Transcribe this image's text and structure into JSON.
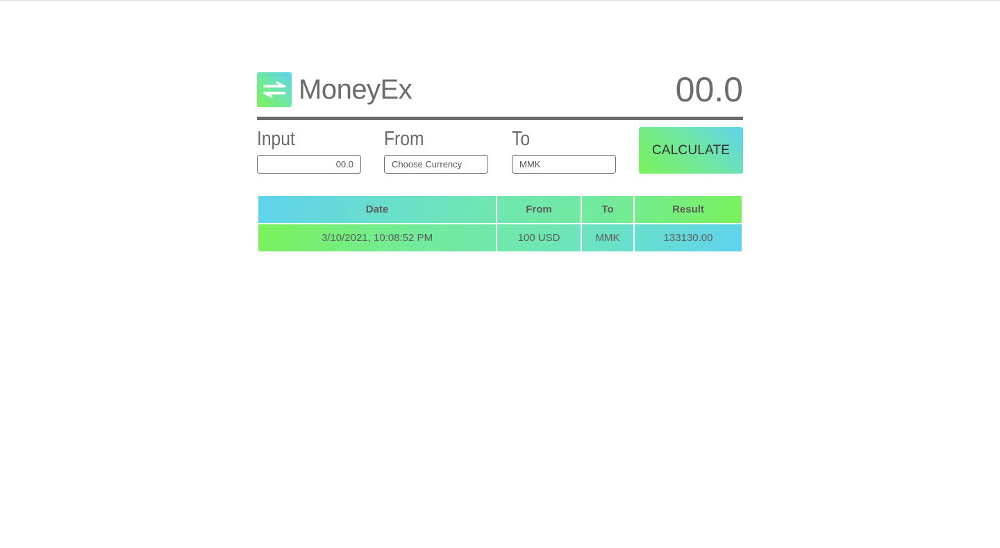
{
  "app": {
    "brand": "MoneyEx",
    "total": "00.0",
    "logo_icon": "swap-arrows-icon"
  },
  "form": {
    "input_label": "Input",
    "input_value": "00.0",
    "from_label": "From",
    "from_value": "Choose Currency",
    "to_label": "To",
    "to_value": "MMK",
    "calculate_label": "CALCULATE"
  },
  "history": {
    "columns": [
      "Date",
      "From",
      "To",
      "Result"
    ],
    "rows": [
      [
        "3/10/2021, 10:08:52 PM",
        "100 USD",
        "MMK",
        "133130.00"
      ]
    ]
  },
  "colors": {
    "accent_green": "#7bf25a",
    "accent_blue": "#5fd3ee",
    "text_gray": "#6b6b6b"
  }
}
